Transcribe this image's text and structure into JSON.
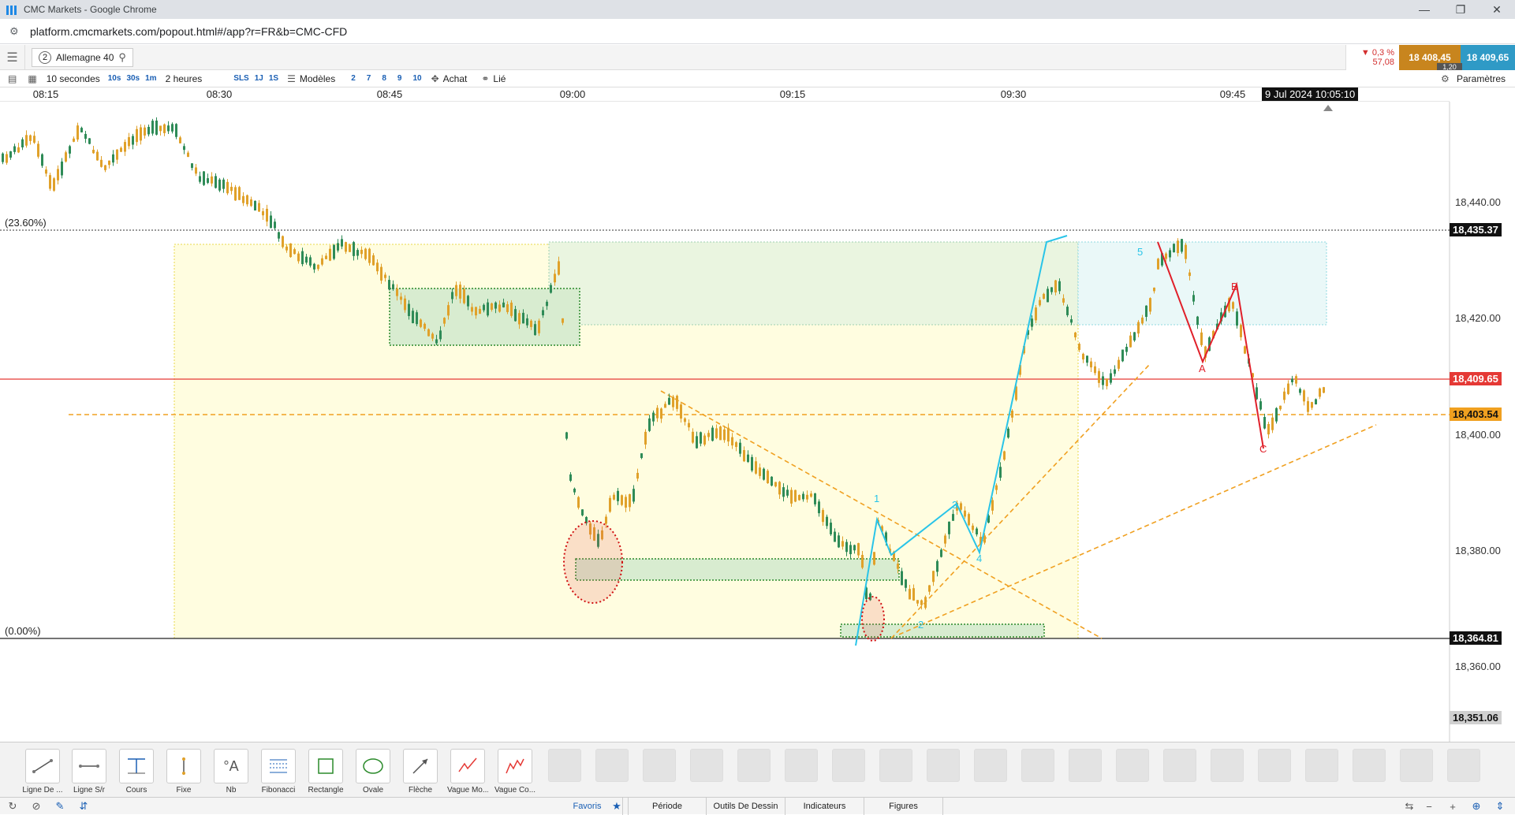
{
  "window": {
    "title": "CMC Markets - Google Chrome"
  },
  "browser": {
    "url": "platform.cmcmarkets.com/popout.html#/app?r=FR&b=CMC-CFD"
  },
  "instrument": {
    "number": "2",
    "name": "Allemagne 40"
  },
  "quote": {
    "change_pct": "▼ 0,3 %",
    "change_abs": "57,08",
    "sell": "18 408,45",
    "buy": "18 409,65",
    "spread": "1,20"
  },
  "toolbar": {
    "interval": "10 secondes",
    "interval_buttons": [
      "10s",
      "30s",
      "1m"
    ],
    "period": "2 heures",
    "period_buttons": [
      "SLS",
      "1J",
      "1S"
    ],
    "models": "Modèles",
    "model_buttons": [
      "2",
      "7",
      "8",
      "9",
      "10"
    ],
    "achat": "Achat",
    "lie": "Lié",
    "params": "Paramètres"
  },
  "time_axis": {
    "labels": [
      "08:15",
      "08:30",
      "08:45",
      "09:00",
      "09:15",
      "09:30",
      "09:45"
    ],
    "current": "9 Jul 2024 10:05:10"
  },
  "chart_data": {
    "type": "candlestick",
    "y_ticks": [
      "18,440.00",
      "18,420.00",
      "18,400.00",
      "18,380.00",
      "18,360.00"
    ],
    "ylim": [
      18346,
      18464
    ],
    "fib_labels": {
      "top": "(23.60%)",
      "bottom": "(0.00%)"
    },
    "levels": {
      "fib_top": "18,435.37",
      "current": "18,409.65",
      "dashed": "18,403.54",
      "fib_bottom": "18,364.81",
      "axis_low": "18,351.06"
    },
    "wave_labels": [
      "1",
      "2",
      "3",
      "4",
      "5"
    ],
    "abc_labels": [
      "A",
      "B",
      "C"
    ],
    "colors": {
      "candle": "#e0a12a",
      "candle_up": "#2e8b57",
      "current_line": "#e53935",
      "wave": "#29c4e8",
      "abc": "#e0202a",
      "trend": "#f0a020"
    }
  },
  "tools": [
    {
      "label": "Ligne De ...",
      "icon": "line-icon"
    },
    {
      "label": "Ligne S/r",
      "icon": "sr-line-icon"
    },
    {
      "label": "Cours",
      "icon": "price-icon"
    },
    {
      "label": "Fixe",
      "icon": "fixed-icon"
    },
    {
      "label": "Nb",
      "icon": "text-icon"
    },
    {
      "label": "Fibonacci",
      "icon": "fibonacci-icon"
    },
    {
      "label": "Rectangle",
      "icon": "rectangle-icon"
    },
    {
      "label": "Ovale",
      "icon": "oval-icon"
    },
    {
      "label": "Flèche",
      "icon": "arrow-icon"
    },
    {
      "label": "Vague Mo...",
      "icon": "wave-icon"
    },
    {
      "label": "Vague Co...",
      "icon": "corrective-wave-icon"
    }
  ],
  "bottom_tabs": [
    "Favoris",
    "Période",
    "Outils De Dessin",
    "Indicateurs",
    "Figures"
  ]
}
